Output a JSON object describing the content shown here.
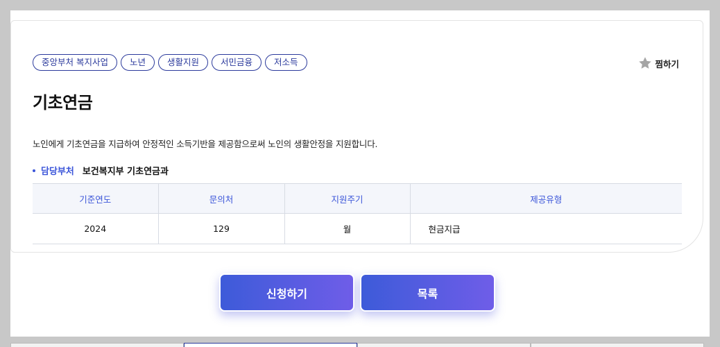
{
  "tags": [
    "중앙부처 복지사업",
    "노년",
    "생활지원",
    "서민금융",
    "저소득"
  ],
  "favorite_label": "찜하기",
  "title": "기초연금",
  "description": "노인에게 기초연금을 지급하여 안정적인 소득기반을 제공함으로써 노인의 생활안정을 지원합니다.",
  "department": {
    "label": "담당부처",
    "value": "보건복지부 기초연금과"
  },
  "table": {
    "headers": [
      "기준연도",
      "문의처",
      "지원주기",
      "제공유형"
    ],
    "row": [
      "2024",
      "129",
      "월",
      "현금지급"
    ]
  },
  "buttons": {
    "apply": "신청하기",
    "list": "목록"
  },
  "colors": {
    "accent": "#3b55d9",
    "tag_border": "#2b3a9c",
    "button_start": "#3d5bd9",
    "button_end": "#6f5de8"
  }
}
